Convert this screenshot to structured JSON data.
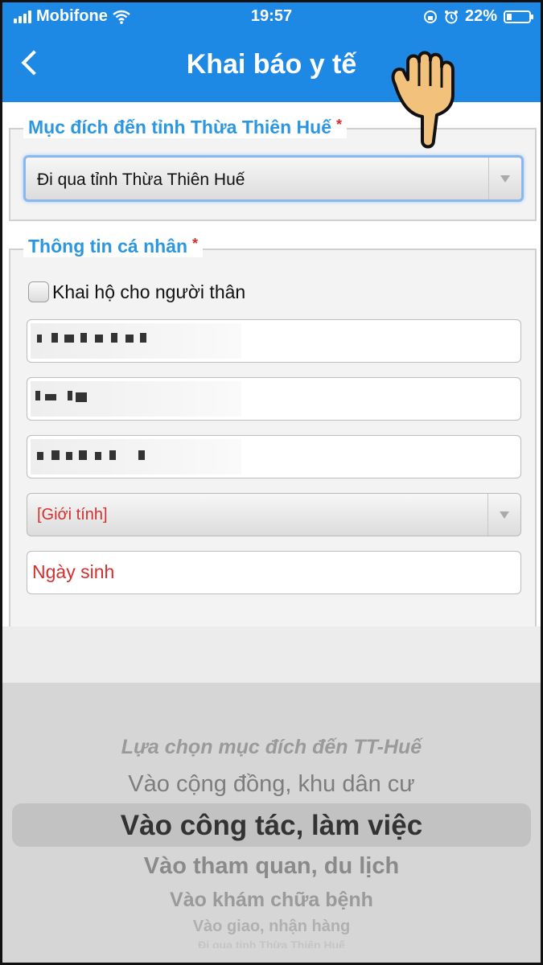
{
  "status_bar": {
    "carrier": "Mobifone",
    "time": "19:57",
    "battery": "22%"
  },
  "header": {
    "title": "Khai báo y tế"
  },
  "purpose_section": {
    "legend": "Mục đích đến tỉnh Thừa Thiên Huế",
    "required_mark": "*",
    "selected_value": "Đi qua tỉnh Thừa Thiên Huế"
  },
  "personal_section": {
    "legend": "Thông tin cá nhân",
    "required_mark": "*",
    "checkbox_label": "Khai hộ cho người thân",
    "gender_placeholder": "[Giới tính]",
    "dob_placeholder": "Ngày sinh"
  },
  "picker": {
    "options": [
      "Lựa chọn mục đích đến TT-Huế",
      "Vào cộng đồng, khu dân cư",
      "Vào công tác, làm việc",
      "Vào tham quan, du lịch",
      "Vào khám chữa bệnh",
      "Vào giao, nhận hàng",
      "Đi qua tỉnh Thừa Thiên Huế"
    ],
    "selected_index": 2
  },
  "colors": {
    "header": "#1e88e5",
    "legend": "#2c97df",
    "required": "#d32f2f",
    "placeholder_red": "#d32f2f"
  }
}
